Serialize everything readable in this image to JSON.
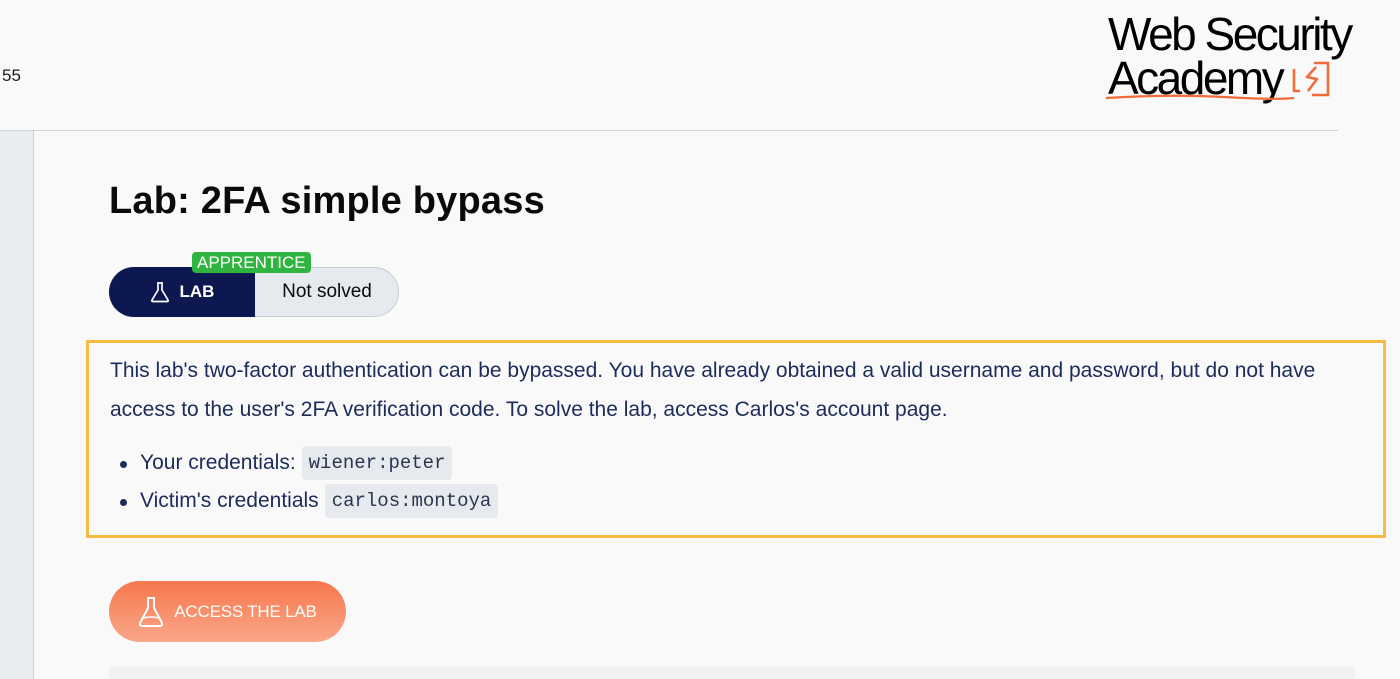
{
  "sidebar_number": "55",
  "logo": {
    "line1": "Web Security",
    "line2": "Academy"
  },
  "lab": {
    "title": "Lab: 2FA simple bypass",
    "badge_label": "LAB",
    "status": "Not solved",
    "level": "APPRENTICE"
  },
  "description": {
    "text": "This lab's two-factor authentication can be bypassed. You have already obtained a valid username and password, but do not have access to the user's 2FA verification code. To solve the lab, access Carlos's account page.",
    "credentials": [
      {
        "label": "Your credentials: ",
        "value": "wiener:peter"
      },
      {
        "label": "Victim's credentials ",
        "value": "carlos:montoya"
      }
    ]
  },
  "access_button": {
    "label": "ACCESS THE LAB",
    "icon": "flask-icon"
  },
  "colors": {
    "navy": "#0d1851",
    "orange": "#f6774d",
    "highlight_border": "#f6bd40",
    "level_green": "#2fb53f"
  }
}
